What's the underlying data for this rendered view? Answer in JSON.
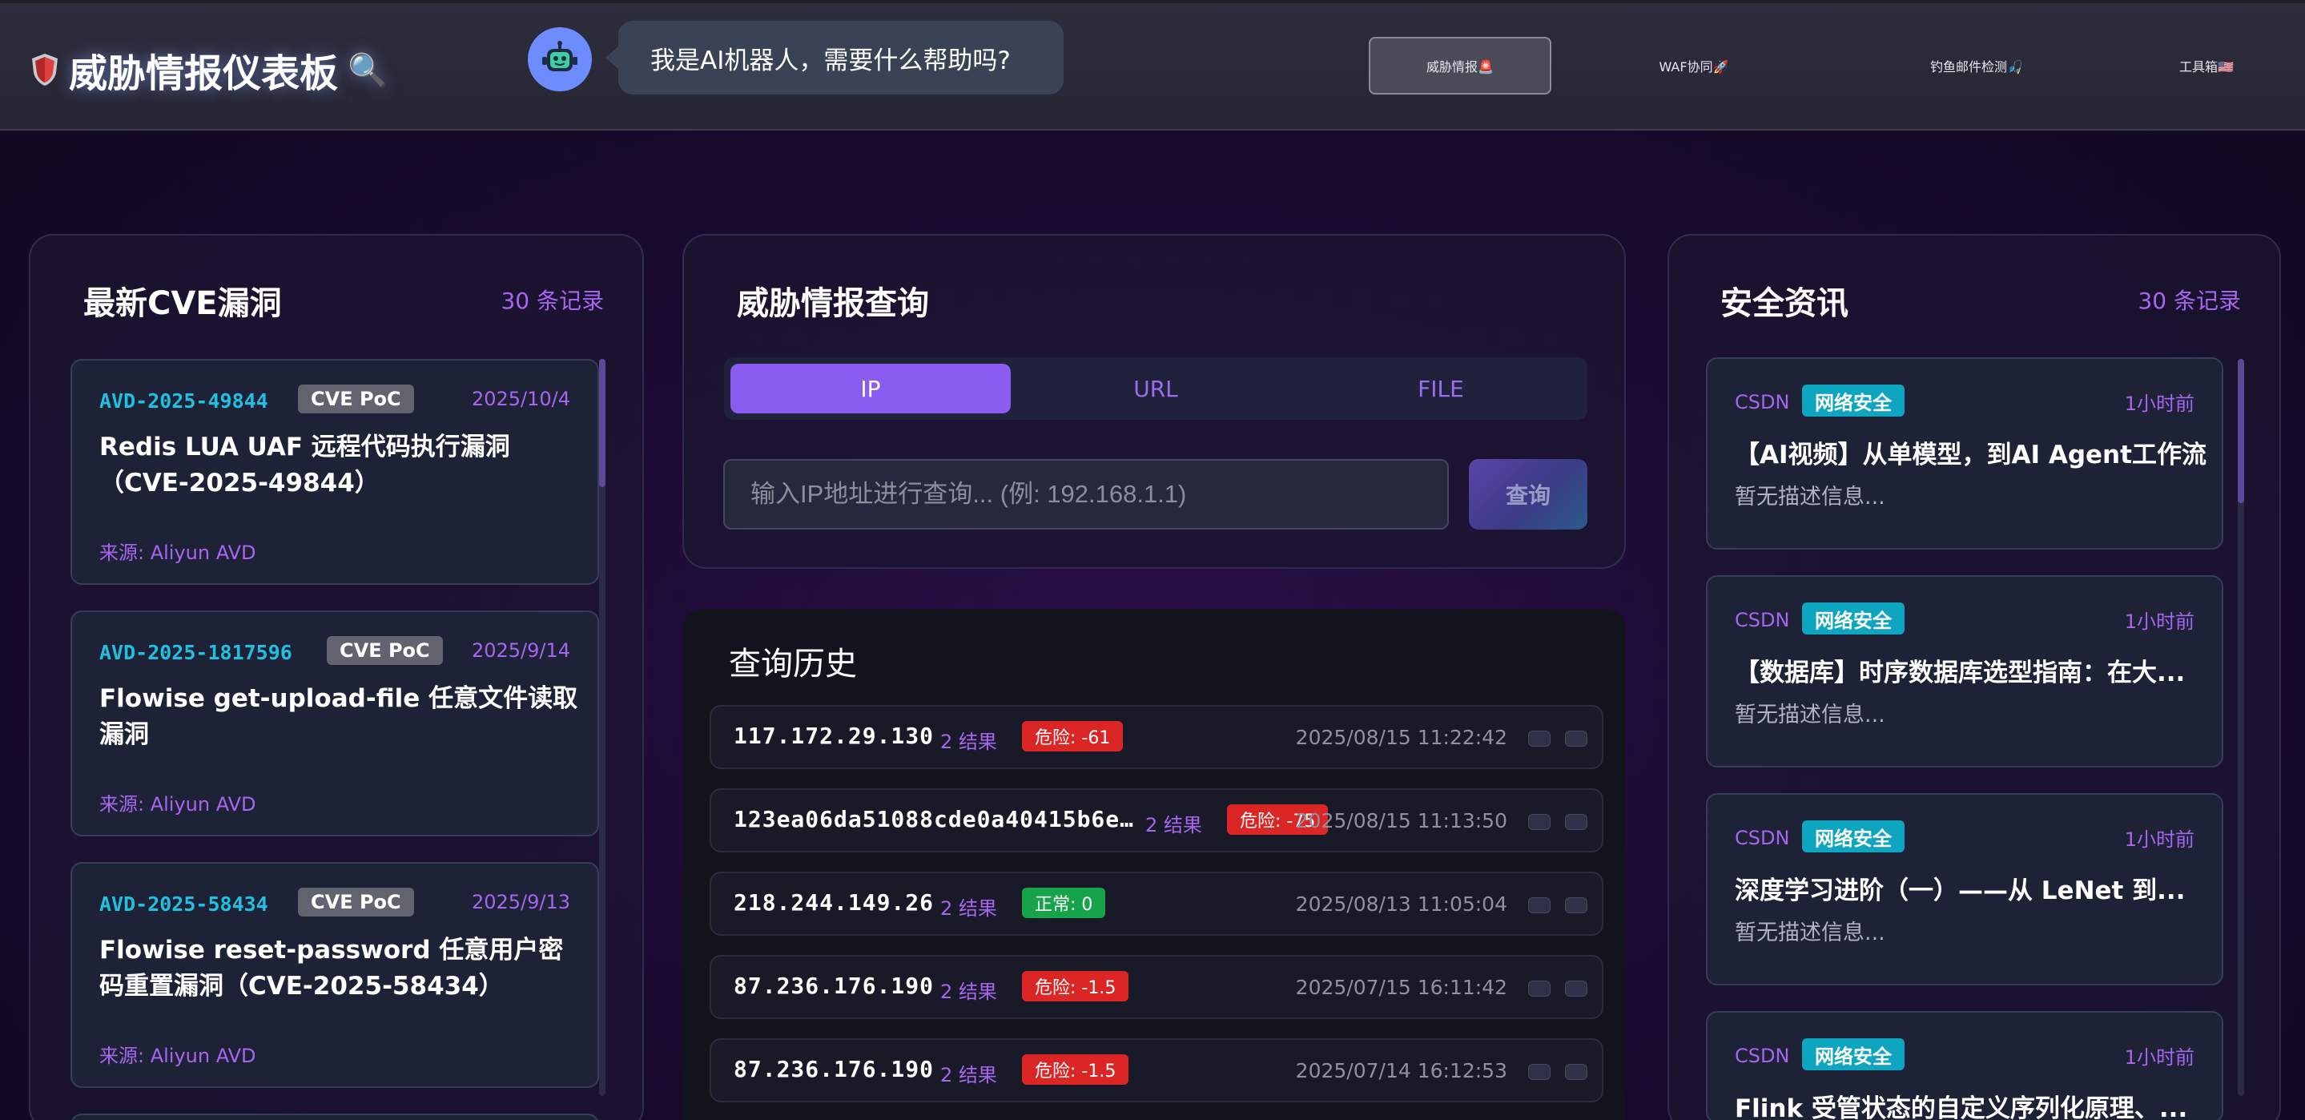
{
  "header": {
    "title": "威胁情报仪表板",
    "title_icon": "shield-icon",
    "title_suffix_icon": "magnifier-icon",
    "bot_message": "我是AI机器人，需要什么帮助吗?",
    "nav": [
      {
        "label": "威胁情报🚨",
        "active": true
      },
      {
        "label": "WAF协同🚀",
        "active": false
      },
      {
        "label": "钓鱼邮件检测🎣",
        "active": false
      },
      {
        "label": "工具箱🇺🇸",
        "active": false
      }
    ]
  },
  "cve": {
    "title": "最新CVE漏洞",
    "count": "30 条记录",
    "items": [
      {
        "id": "AVD-2025-49844",
        "badge": "CVE PoC",
        "date": "2025/10/4",
        "title": "Redis LUA UAF 远程代码执行漏洞（CVE-2025-49844）",
        "source": "来源: Aliyun AVD"
      },
      {
        "id": "AVD-2025-1817596",
        "badge": "CVE PoC",
        "date": "2025/9/14",
        "title": "Flowise get-upload-file 任意文件读取漏洞",
        "source": "来源: Aliyun AVD"
      },
      {
        "id": "AVD-2025-58434",
        "badge": "CVE PoC",
        "date": "2025/9/13",
        "title": "Flowise reset-password 任意用户密码重置漏洞（CVE-2025-58434）",
        "source": "来源: Aliyun AVD"
      }
    ]
  },
  "query": {
    "title": "威胁情报查询",
    "tabs": [
      "IP",
      "URL",
      "FILE"
    ],
    "active_tab": "IP",
    "input_placeholder": "输入IP地址进行查询... (例: 192.168.1.1)",
    "input_value": "",
    "button_label": "查询"
  },
  "history": {
    "title": "查询历史",
    "rows": [
      {
        "target": "117.172.29.130",
        "results": "2 结果",
        "risk": "危险: -61",
        "risk_level": "danger",
        "time": "2025/08/15 11:22:42"
      },
      {
        "target": "123ea06da51088cde0a40415b6e…",
        "results": "2 结果",
        "risk": "危险: -75",
        "risk_level": "danger",
        "time": "2025/08/15 11:13:50"
      },
      {
        "target": "218.244.149.26",
        "results": "2 结果",
        "risk": "正常: 0",
        "risk_level": "safe",
        "time": "2025/08/13 11:05:04"
      },
      {
        "target": "87.236.176.190",
        "results": "2 结果",
        "risk": "危险: -1.5",
        "risk_level": "danger",
        "time": "2025/07/15 16:11:42"
      },
      {
        "target": "87.236.176.190",
        "results": "2 结果",
        "risk": "危险: -1.5",
        "risk_level": "danger",
        "time": "2025/07/14 16:12:53"
      }
    ]
  },
  "news": {
    "title": "安全资讯",
    "count": "30 条记录",
    "items": [
      {
        "source": "CSDN",
        "tag": "网络安全",
        "time": "1小时前",
        "title": "【AI视频】从单模型，到AI Agent工作流",
        "desc": "暂无描述信息..."
      },
      {
        "source": "CSDN",
        "tag": "网络安全",
        "time": "1小时前",
        "title": "【数据库】时序数据库选型指南：在大...",
        "desc": "暂无描述信息..."
      },
      {
        "source": "CSDN",
        "tag": "网络安全",
        "time": "1小时前",
        "title": "深度学习进阶（一）——从 LeNet 到...",
        "desc": "暂无描述信息..."
      },
      {
        "source": "CSDN",
        "tag": "网络安全",
        "time": "1小时前",
        "title": "Flink 受管状态的自定义序列化原理、...",
        "desc": ""
      }
    ]
  },
  "colors": {
    "accent_purple": "#8a5cf0",
    "cve_id_cyan": "#1fc0e0",
    "danger_red": "#dc2626",
    "safe_green": "#16a34a",
    "news_tag_teal": "#0ea5c0"
  }
}
